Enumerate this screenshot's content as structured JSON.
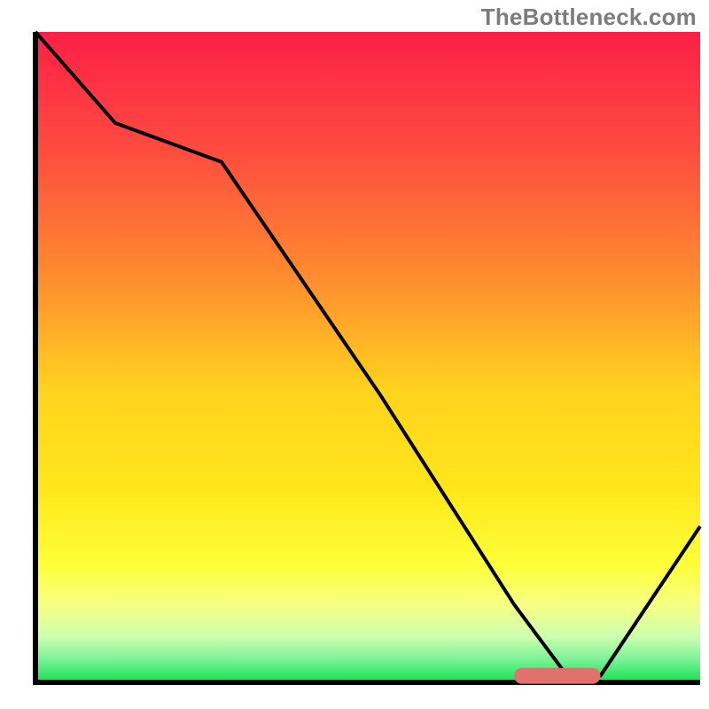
{
  "watermark": {
    "text": "TheBottleneck.com"
  },
  "chart_data": {
    "type": "line",
    "title": "",
    "xlabel": "",
    "ylabel": "",
    "xlim": [
      0,
      100
    ],
    "ylim": [
      0,
      100
    ],
    "x": [
      0,
      12,
      28,
      52,
      72,
      80,
      85,
      100
    ],
    "values": [
      100,
      86,
      80,
      44,
      12,
      1,
      1,
      24
    ],
    "optimal_band": {
      "x_start": 72,
      "x_end": 85,
      "y": 1
    },
    "background_gradient": {
      "stops": [
        {
          "offset": 0.0,
          "color": "#fd1f47"
        },
        {
          "offset": 0.18,
          "color": "#fe4b3f"
        },
        {
          "offset": 0.38,
          "color": "#ff8d2f"
        },
        {
          "offset": 0.55,
          "color": "#ffd31e"
        },
        {
          "offset": 0.7,
          "color": "#ffe61a"
        },
        {
          "offset": 0.82,
          "color": "#fdff39"
        },
        {
          "offset": 0.88,
          "color": "#f7ff82"
        },
        {
          "offset": 0.93,
          "color": "#cdffb0"
        },
        {
          "offset": 0.965,
          "color": "#7af297"
        },
        {
          "offset": 1.0,
          "color": "#14e24f"
        }
      ]
    }
  }
}
